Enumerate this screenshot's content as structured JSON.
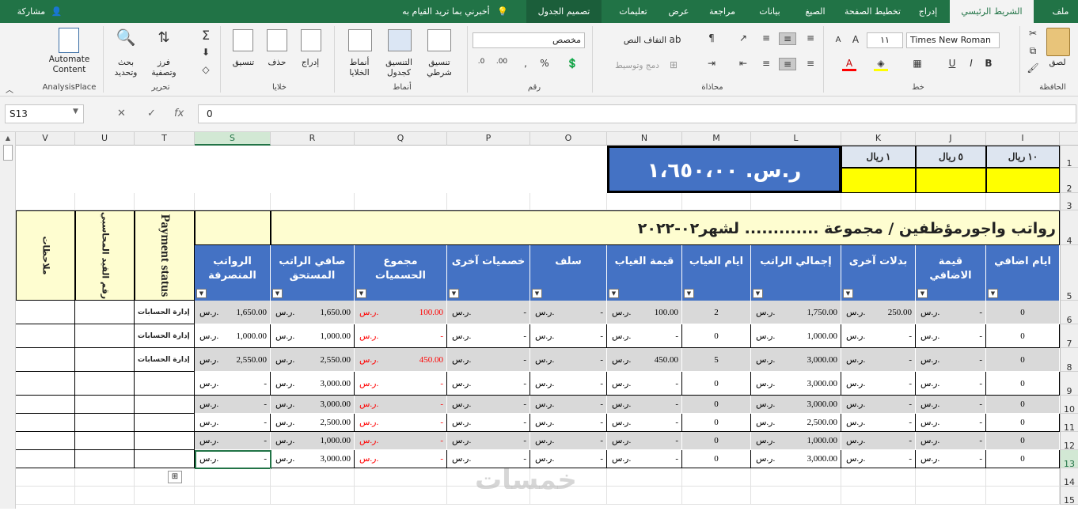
{
  "tabs": [
    {
      "label": "ملف",
      "active": false
    },
    {
      "label": "الشريط الرئيسي",
      "active": true
    },
    {
      "label": "إدراج",
      "active": false
    },
    {
      "label": "تخطيط الصفحة",
      "active": false
    },
    {
      "label": "الصيغ",
      "active": false
    },
    {
      "label": "بيانات",
      "active": false
    },
    {
      "label": "مراجعة",
      "active": false
    },
    {
      "label": "عرض",
      "active": false
    },
    {
      "label": "تعليمات",
      "active": false
    },
    {
      "label": "تصميم الجدول",
      "active": false
    }
  ],
  "tell_me": "أخبرني بما تريد القيام به",
  "share": "مشاركة",
  "ribbon": {
    "clipboard": {
      "paste": "لصق",
      "label": "الحافظة"
    },
    "font": {
      "name": "Times New Roman",
      "size": "١١",
      "label": "خط"
    },
    "alignment": {
      "wrap": "التفاف النص",
      "merge": "دمج وتوسيط",
      "label": "محاذاة"
    },
    "number": {
      "format": "مخصص",
      "label": "رقم"
    },
    "styles": {
      "conditional": "تنسيق شرطي",
      "table": "التنسيق كجدول",
      "cell": "أنماط الخلايا",
      "label": "أنماط"
    },
    "cells": {
      "insert": "إدراج",
      "delete": "حذف",
      "format": "تنسيق",
      "label": "خلايا"
    },
    "editing": {
      "sort": "فرز وتصفية",
      "find": "بحث وتحديد",
      "label": "تحرير"
    },
    "analysis": {
      "automate": "Automate Content",
      "label": "AnalysisPlace"
    }
  },
  "formula_bar": {
    "name_box": "S13",
    "formula": "0"
  },
  "columns": [
    "I",
    "J",
    "K",
    "L",
    "M",
    "N",
    "O",
    "P",
    "Q",
    "R",
    "S",
    "T",
    "U",
    "V"
  ],
  "rows": [
    "1",
    "2",
    "3",
    "4",
    "5",
    "6",
    "7",
    "8",
    "9",
    "10",
    "11",
    "12",
    "13",
    "14",
    "15"
  ],
  "selected_col": "S",
  "selected_row": "13",
  "total_box": "ر.س. ١،٦٥٠،٠٠",
  "denominations": [
    "١٠ ريال",
    "٥ ريال",
    "١ ريال"
  ],
  "sheet_title": "رواتب واجورمؤظفين / مجموعة ............. لشهر٠٢-٢٠٢٢",
  "payment_status_header": "Payment status",
  "accounting_no_header": "رقم القيد المحاسبي",
  "notes_header": "ملاحظات",
  "table_headers": [
    "ايام اضافي",
    "قيمة الاضافي",
    "بدلات آخرى",
    "إجمالي الراتب",
    "ايام الغياب",
    "قيمة الغياب",
    "سلف",
    "خصميات آخرى",
    "مجموع الحسميات",
    "صافي الراتب المستحق",
    "الرواتب المنصرفة"
  ],
  "currency": "ر.س.",
  "dash": "-",
  "table_rows": [
    {
      "extra_days": "0",
      "extra_value": "-",
      "allowances": "250.00",
      "total_salary": "1,750.00",
      "absence_days": "2",
      "absence_value": "100.00",
      "advance": "-",
      "other_deduct": "-",
      "total_deduct": "100.00",
      "net_salary": "1,650.00",
      "paid": "1,650.00",
      "status": "إدارة الحسابات"
    },
    {
      "extra_days": "0",
      "extra_value": "-",
      "allowances": "-",
      "total_salary": "1,000.00",
      "absence_days": "0",
      "absence_value": "-",
      "advance": "-",
      "other_deduct": "-",
      "total_deduct": "-",
      "net_salary": "1,000.00",
      "paid": "1,000.00",
      "status": "إدارة الحسابات"
    },
    {
      "extra_days": "0",
      "extra_value": "-",
      "allowances": "-",
      "total_salary": "3,000.00",
      "absence_days": "5",
      "absence_value": "450.00",
      "advance": "-",
      "other_deduct": "-",
      "total_deduct": "450.00",
      "net_salary": "2,550.00",
      "paid": "2,550.00",
      "status": "إدارة الحسابات"
    },
    {
      "extra_days": "0",
      "extra_value": "-",
      "allowances": "-",
      "total_salary": "3,000.00",
      "absence_days": "0",
      "absence_value": "-",
      "advance": "-",
      "other_deduct": "-",
      "total_deduct": "-",
      "net_salary": "3,000.00",
      "paid": "-",
      "status": ""
    },
    {
      "extra_days": "0",
      "extra_value": "-",
      "allowances": "-",
      "total_salary": "3,000.00",
      "absence_days": "0",
      "absence_value": "-",
      "advance": "-",
      "other_deduct": "-",
      "total_deduct": "-",
      "net_salary": "3,000.00",
      "paid": "-",
      "status": ""
    },
    {
      "extra_days": "0",
      "extra_value": "-",
      "allowances": "-",
      "total_salary": "2,500.00",
      "absence_days": "0",
      "absence_value": "-",
      "advance": "-",
      "other_deduct": "-",
      "total_deduct": "-",
      "net_salary": "2,500.00",
      "paid": "-",
      "status": ""
    },
    {
      "extra_days": "0",
      "extra_value": "-",
      "allowances": "-",
      "total_salary": "1,000.00",
      "absence_days": "0",
      "absence_value": "-",
      "advance": "-",
      "other_deduct": "-",
      "total_deduct": "-",
      "net_salary": "1,000.00",
      "paid": "-",
      "status": ""
    },
    {
      "extra_days": "0",
      "extra_value": "-",
      "allowances": "-",
      "total_salary": "3,000.00",
      "absence_days": "0",
      "absence_value": "-",
      "advance": "-",
      "other_deduct": "-",
      "total_deduct": "-",
      "net_salary": "3,000.00",
      "paid": "-",
      "status": ""
    }
  ],
  "watermark": "خمسات",
  "colors": {
    "excel_green": "#217346",
    "header_blue": "#4472c4",
    "yellow": "#ffff00",
    "light_yellow": "#fefdd0",
    "red_text": "#ff0000",
    "row_gray": "#d9d9d9"
  }
}
